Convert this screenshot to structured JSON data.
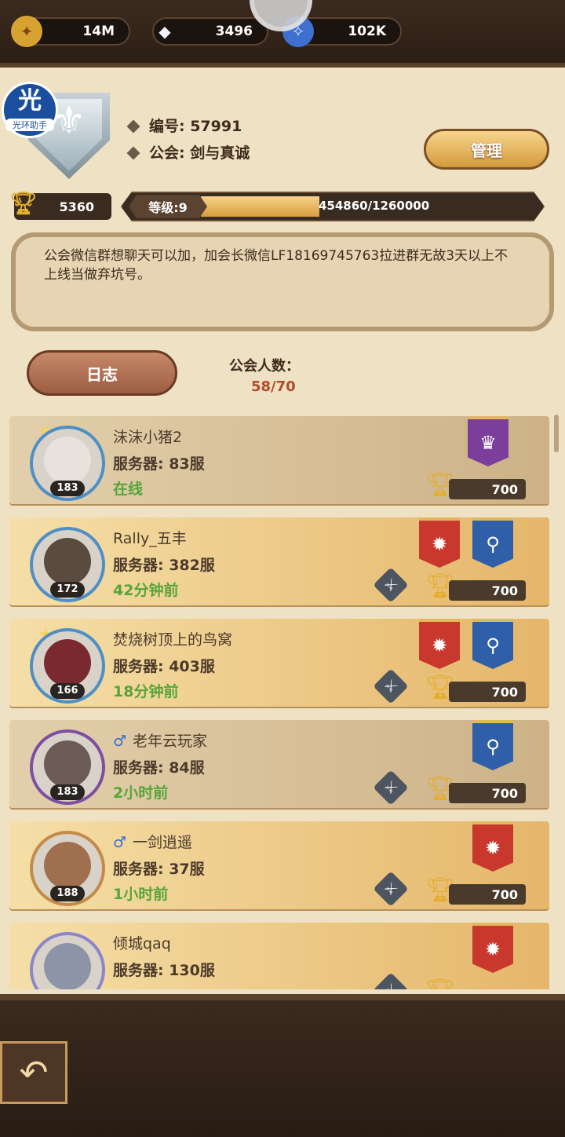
{
  "resources": [
    {
      "icon": "gold-coin-icon",
      "value": "14M"
    },
    {
      "icon": "diamond-icon",
      "value": "3496"
    },
    {
      "icon": "essence-icon",
      "value": "102K"
    }
  ],
  "assistant_badge": {
    "char": "光",
    "label": "光环助手"
  },
  "guild": {
    "id_label": "编号: 57991",
    "name_label": "公会: 剑与真诚",
    "manage_button": "管理",
    "trophies": "5360",
    "level_label": "等级:9",
    "xp_text": "454860/1260000",
    "xp_current": 454860,
    "xp_max": 1260000,
    "notice": "公会微信群想聊天可以加，加会长微信LF18169745763拉进群无故3天以上不上线当做弃坑号。"
  },
  "log_button": "日志",
  "member_count_label": "公会人数：",
  "member_count_value": "58/70",
  "members": [
    {
      "name": "沫沫小猪2",
      "gender": "",
      "server": "服务器: 83服",
      "status": "在线",
      "level": "183",
      "points": "700",
      "banners": [
        "purple"
      ],
      "has_swords": false,
      "star": true
    },
    {
      "name": "Rally_五丰",
      "gender": "",
      "server": "服务器: 382服",
      "status": "42分钟前",
      "level": "172",
      "points": "700",
      "banners": [
        "red",
        "blue"
      ],
      "has_swords": true,
      "star": false
    },
    {
      "name": "焚烧树顶上的鸟窝",
      "gender": "",
      "server": "服务器: 403服",
      "status": "18分钟前",
      "level": "166",
      "points": "700",
      "banners": [
        "red",
        "blue"
      ],
      "has_swords": true,
      "star": true
    },
    {
      "name": "老年云玩家",
      "gender": "♂",
      "server": "服务器: 84服",
      "status": "2小时前",
      "level": "183",
      "points": "700",
      "banners": [
        "blue"
      ],
      "has_swords": true,
      "star": false
    },
    {
      "name": "一剑逍遥",
      "gender": "♂",
      "server": "服务器: 37服",
      "status": "1小时前",
      "level": "188",
      "points": "700",
      "banners": [
        "red"
      ],
      "has_swords": true,
      "star": false
    },
    {
      "name": "倾城qaq",
      "gender": "",
      "server": "服务器: 130服",
      "status": "",
      "level": "",
      "points": "",
      "banners": [
        "red"
      ],
      "has_swords": true,
      "star": false
    }
  ],
  "back_icon": "back-arrow-icon"
}
